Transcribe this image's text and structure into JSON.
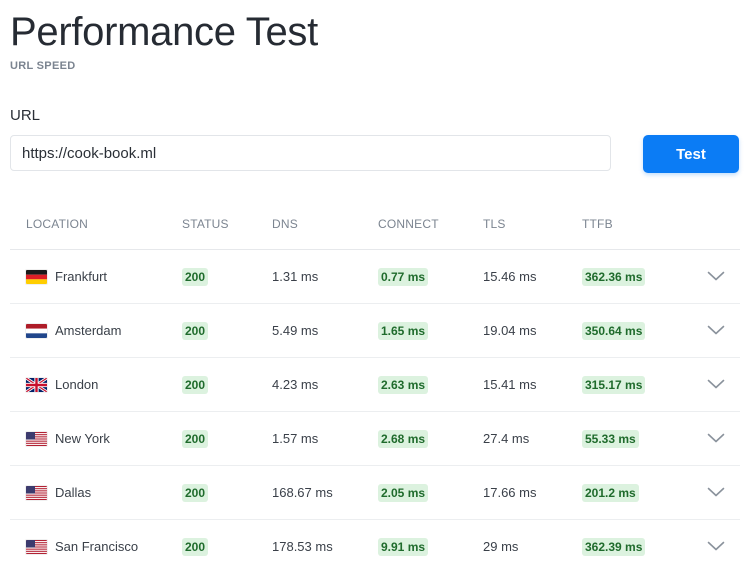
{
  "header": {
    "title": "Performance Test",
    "subtitle": "URL SPEED"
  },
  "form": {
    "url_label": "URL",
    "url_value": "https://cook-book.ml",
    "test_label": "Test"
  },
  "table": {
    "columns": [
      "LOCATION",
      "STATUS",
      "DNS",
      "CONNECT",
      "TLS",
      "TTFB"
    ],
    "rows": [
      {
        "flag": "de",
        "location": "Frankfurt",
        "status": "200",
        "dns": "1.31 ms",
        "connect": "0.77 ms",
        "tls": "15.46 ms",
        "ttfb": "362.36 ms"
      },
      {
        "flag": "nl",
        "location": "Amsterdam",
        "status": "200",
        "dns": "5.49 ms",
        "connect": "1.65 ms",
        "tls": "19.04 ms",
        "ttfb": "350.64 ms"
      },
      {
        "flag": "gb",
        "location": "London",
        "status": "200",
        "dns": "4.23 ms",
        "connect": "2.63 ms",
        "tls": "15.41 ms",
        "ttfb": "315.17 ms"
      },
      {
        "flag": "us",
        "location": "New York",
        "status": "200",
        "dns": "1.57 ms",
        "connect": "2.68 ms",
        "tls": "27.4 ms",
        "ttfb": "55.33 ms"
      },
      {
        "flag": "us",
        "location": "Dallas",
        "status": "200",
        "dns": "168.67 ms",
        "connect": "2.05 ms",
        "tls": "17.66 ms",
        "ttfb": "201.2 ms"
      },
      {
        "flag": "us",
        "location": "San Francisco",
        "status": "200",
        "dns": "178.53 ms",
        "connect": "9.91 ms",
        "tls": "29 ms",
        "ttfb": "362.39 ms"
      }
    ]
  },
  "colors": {
    "accent": "#0b7cf5",
    "badge_bg": "#dcf2df",
    "badge_text": "#1f6b2c",
    "muted": "#7b8490"
  },
  "icons": {
    "expand": "chevron-down-icon"
  }
}
